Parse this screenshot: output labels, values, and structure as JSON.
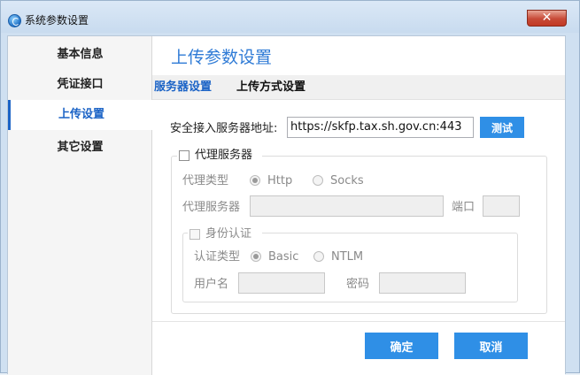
{
  "window": {
    "title": "系统参数设置",
    "close_glyph": "✕"
  },
  "sidebar": {
    "items": [
      {
        "label": "基本信息"
      },
      {
        "label": "凭证接口"
      },
      {
        "label": "上传设置"
      },
      {
        "label": "其它设置"
      }
    ]
  },
  "main": {
    "title": "上传参数设置",
    "tabs": [
      {
        "label": "服务器设置"
      },
      {
        "label": "上传方式设置"
      }
    ],
    "server": {
      "label": "安全接入服务器地址:",
      "value": "https://skfp.tax.sh.gov.cn:443",
      "test_label": "测试"
    },
    "proxy": {
      "label": "代理服务器",
      "type_label": "代理类型",
      "type_options": [
        "Http",
        "Socks"
      ],
      "server_label": "代理服务器",
      "server_value": "",
      "port_label": "端口",
      "port_value": ""
    },
    "auth": {
      "label": "身份认证",
      "type_label": "认证类型",
      "type_options": [
        "Basic",
        "NTLM"
      ],
      "user_label": "用户名",
      "user_value": "",
      "password_label": "密码",
      "password_value": ""
    },
    "footer": {
      "ok_label": "确定",
      "cancel_label": "取消"
    }
  },
  "colors": {
    "accent": "#2f8fe6",
    "active_text": "#1b63c6",
    "title": "#2f7bd6"
  }
}
